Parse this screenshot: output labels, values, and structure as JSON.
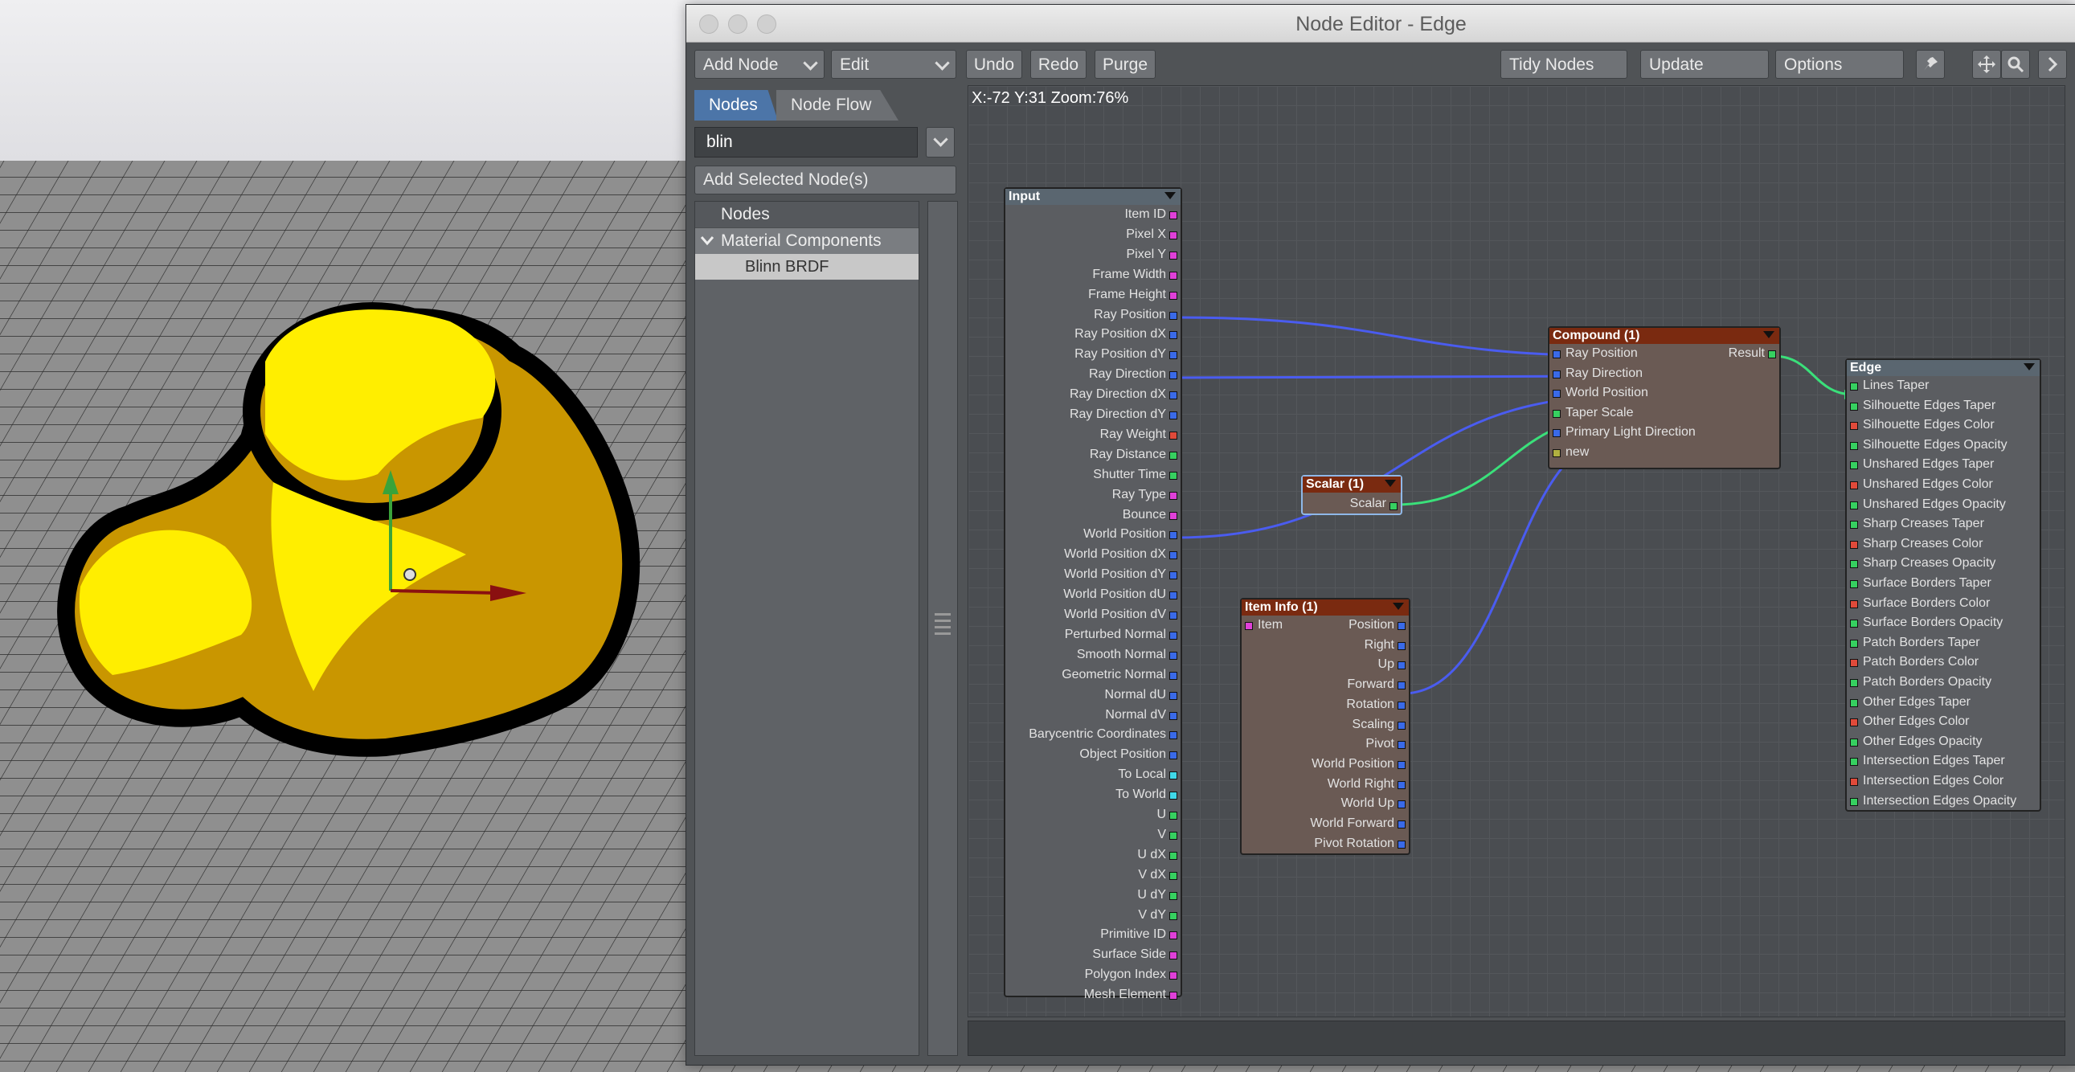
{
  "window": {
    "title": "Node Editor - Edge"
  },
  "toolbar": {
    "add_node": "Add Node",
    "edit": "Edit",
    "undo": "Undo",
    "redo": "Redo",
    "purge": "Purge",
    "tidy_nodes": "Tidy Nodes",
    "update": "Update",
    "options": "Options"
  },
  "sidebar": {
    "tabs": [
      "Nodes",
      "Node Flow"
    ],
    "search_value": "blin",
    "add_selected": "Add Selected Node(s)",
    "list_header": "Nodes",
    "category": "Material Components",
    "item": "Blinn BRDF"
  },
  "graph": {
    "status": "X:-72 Y:31 Zoom:76%"
  },
  "colors": {
    "port_magenta": "#e040d8",
    "port_blue": "#3a6ae8",
    "port_green": "#36d060",
    "port_red": "#e04a3a",
    "port_cyan": "#40d8e8",
    "port_olive": "#b0b040",
    "wire_blue": "#4a5cf0",
    "wire_green": "#3ae07a",
    "node_header_brown": "#7a2a10",
    "node_header_gray": "#5a6670"
  },
  "nodes": {
    "input": {
      "title": "Input",
      "ports": [
        {
          "label": "Item ID",
          "color": "port_magenta"
        },
        {
          "label": "Pixel X",
          "color": "port_magenta"
        },
        {
          "label": "Pixel Y",
          "color": "port_magenta"
        },
        {
          "label": "Frame Width",
          "color": "port_magenta"
        },
        {
          "label": "Frame Height",
          "color": "port_magenta"
        },
        {
          "label": "Ray Position",
          "color": "port_blue"
        },
        {
          "label": "Ray Position dX",
          "color": "port_blue"
        },
        {
          "label": "Ray Position dY",
          "color": "port_blue"
        },
        {
          "label": "Ray Direction",
          "color": "port_blue"
        },
        {
          "label": "Ray Direction dX",
          "color": "port_blue"
        },
        {
          "label": "Ray Direction dY",
          "color": "port_blue"
        },
        {
          "label": "Ray Weight",
          "color": "port_red"
        },
        {
          "label": "Ray Distance",
          "color": "port_green"
        },
        {
          "label": "Shutter Time",
          "color": "port_green"
        },
        {
          "label": "Ray Type",
          "color": "port_magenta"
        },
        {
          "label": "Bounce",
          "color": "port_magenta"
        },
        {
          "label": "World Position",
          "color": "port_blue"
        },
        {
          "label": "World Position dX",
          "color": "port_blue"
        },
        {
          "label": "World Position dY",
          "color": "port_blue"
        },
        {
          "label": "World Position dU",
          "color": "port_blue"
        },
        {
          "label": "World Position dV",
          "color": "port_blue"
        },
        {
          "label": "Perturbed Normal",
          "color": "port_blue"
        },
        {
          "label": "Smooth Normal",
          "color": "port_blue"
        },
        {
          "label": "Geometric Normal",
          "color": "port_blue"
        },
        {
          "label": "Normal dU",
          "color": "port_blue"
        },
        {
          "label": "Normal dV",
          "color": "port_blue"
        },
        {
          "label": "Barycentric Coordinates",
          "color": "port_blue"
        },
        {
          "label": "Object Position",
          "color": "port_blue"
        },
        {
          "label": "To Local",
          "color": "port_cyan"
        },
        {
          "label": "To World",
          "color": "port_cyan"
        },
        {
          "label": "U",
          "color": "port_green"
        },
        {
          "label": "V",
          "color": "port_green"
        },
        {
          "label": "U dX",
          "color": "port_green"
        },
        {
          "label": "V dX",
          "color": "port_green"
        },
        {
          "label": "U dY",
          "color": "port_green"
        },
        {
          "label": "V dY",
          "color": "port_green"
        },
        {
          "label": "Primitive ID",
          "color": "port_magenta"
        },
        {
          "label": "Surface Side",
          "color": "port_magenta"
        },
        {
          "label": "Polygon Index",
          "color": "port_magenta"
        },
        {
          "label": "Mesh Element",
          "color": "port_magenta"
        }
      ]
    },
    "scalar": {
      "title": "Scalar (1)",
      "output": "Scalar"
    },
    "item_info": {
      "title": "Item Info (1)",
      "input": "Item",
      "outputs": [
        "Position",
        "Right",
        "Up",
        "Forward",
        "Rotation",
        "Scaling",
        "Pivot",
        "World Position",
        "World Right",
        "World Up",
        "World Forward",
        "Pivot Rotation"
      ]
    },
    "compound": {
      "title": "Compound (1)",
      "output": "Result",
      "inputs": [
        {
          "label": "Ray Position",
          "color": "port_blue"
        },
        {
          "label": "Ray Direction",
          "color": "port_blue"
        },
        {
          "label": "World Position",
          "color": "port_blue"
        },
        {
          "label": "Taper Scale",
          "color": "port_green"
        },
        {
          "label": "Primary Light Direction",
          "color": "port_blue"
        },
        {
          "label": "new",
          "color": "port_olive"
        }
      ]
    },
    "edge": {
      "title": "Edge",
      "inputs": [
        {
          "label": "Lines Taper",
          "color": "port_green"
        },
        {
          "label": "Silhouette Edges Taper",
          "color": "port_green"
        },
        {
          "label": "Silhouette Edges Color",
          "color": "port_red"
        },
        {
          "label": "Silhouette Edges Opacity",
          "color": "port_green"
        },
        {
          "label": "Unshared Edges Taper",
          "color": "port_green"
        },
        {
          "label": "Unshared Edges Color",
          "color": "port_red"
        },
        {
          "label": "Unshared Edges Opacity",
          "color": "port_green"
        },
        {
          "label": "Sharp Creases Taper",
          "color": "port_green"
        },
        {
          "label": "Sharp Creases Color",
          "color": "port_red"
        },
        {
          "label": "Sharp Creases Opacity",
          "color": "port_green"
        },
        {
          "label": "Surface Borders Taper",
          "color": "port_green"
        },
        {
          "label": "Surface Borders Color",
          "color": "port_red"
        },
        {
          "label": "Surface Borders Opacity",
          "color": "port_green"
        },
        {
          "label": "Patch Borders Taper",
          "color": "port_green"
        },
        {
          "label": "Patch Borders Color",
          "color": "port_red"
        },
        {
          "label": "Patch Borders Opacity",
          "color": "port_green"
        },
        {
          "label": "Other Edges Taper",
          "color": "port_green"
        },
        {
          "label": "Other Edges Color",
          "color": "port_red"
        },
        {
          "label": "Other Edges Opacity",
          "color": "port_green"
        },
        {
          "label": "Intersection Edges Taper",
          "color": "port_green"
        },
        {
          "label": "Intersection Edges Color",
          "color": "port_red"
        },
        {
          "label": "Intersection Edges Opacity",
          "color": "port_green"
        }
      ]
    }
  }
}
